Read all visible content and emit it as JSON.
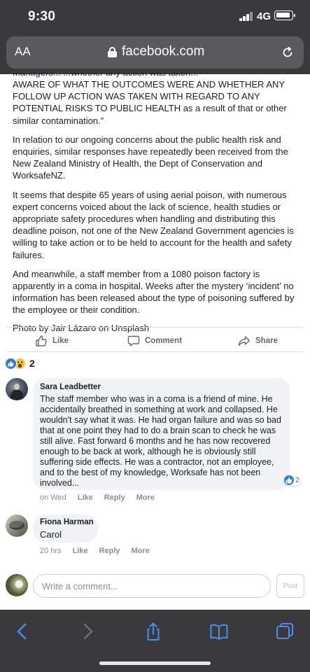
{
  "status_bar": {
    "time": "9:30",
    "network": "4G"
  },
  "browser": {
    "text_size_label": "AA",
    "domain": "facebook.com",
    "icons": [
      "lock-icon",
      "reload-icon"
    ]
  },
  "article": {
    "cut_line": "Managers... ...whether any action was taken...",
    "paragraphs": [
      "AWARE OF WHAT THE OUTCOMES WERE AND WHETHER ANY FOLLOW UP ACTION WAS TAKEN WITH REGARD TO ANY POTENTIAL RISKS TO PUBLIC HEALTH as a result of that or other similar contamination.”",
      "In relation to our ongoing concerns about the public health risk and enquiries, similar responses have repeatedly been received from the New Zealand Ministry of Health, the Dept of Conservation and WorksafeNZ.",
      "It seems that despite 65 years of using aerial poison, with numerous expert concerns voiced about the lack of science, health studies or appropriate safety procedures when handling and distributing this deadline poison, not one of the New Zealand Government agencies is willing to take action or to be held to account for the health and safety failures.",
      "And meanwhile, a staff member from a 1080 poison factory is apparently in a coma in hospital. Weeks after the mystery ‘incident’ no information has been released about the type of poisoning suffered by the employee or their condition."
    ],
    "photo_credit": "Photo by Jair Lázaro on Unsplash"
  },
  "actions": {
    "like": "Like",
    "comment": "Comment",
    "share": "Share"
  },
  "reactions": {
    "types": [
      "like",
      "wow"
    ],
    "count": "2"
  },
  "comments": [
    {
      "author": "Sara Leadbetter",
      "text": "The staff member who was in a coma is a friend of mine. He accidentally breathed in something at work and collapsed. He wouldn't say what it was. He had organ failure and was so bad that at one point they had to do a brain scan to check he was still alive. Fast forward 6 months and he has now recovered enough to be back at work, although he is obviously still suffering side effects. He was a contractor, not an employee, and to the best of my knowledge, Worksafe has not been involved...",
      "reaction_count": "2",
      "time": "on Wed",
      "like": "Like",
      "reply": "Reply",
      "more": "More"
    },
    {
      "author": "Fiona Harman",
      "text": "Carol",
      "time": "20 hrs",
      "like": "Like",
      "reply": "Reply",
      "more": "More"
    }
  ],
  "compose": {
    "placeholder": "Write a comment...",
    "post_label": "Post"
  },
  "toolbar": {
    "icons": [
      "back-icon",
      "forward-icon",
      "share-icon",
      "bookmarks-icon",
      "tabs-icon"
    ]
  },
  "colors": {
    "chrome": "#3a3a3c",
    "accent": "#4a8cf0",
    "bubble": "#f0f2f5"
  }
}
